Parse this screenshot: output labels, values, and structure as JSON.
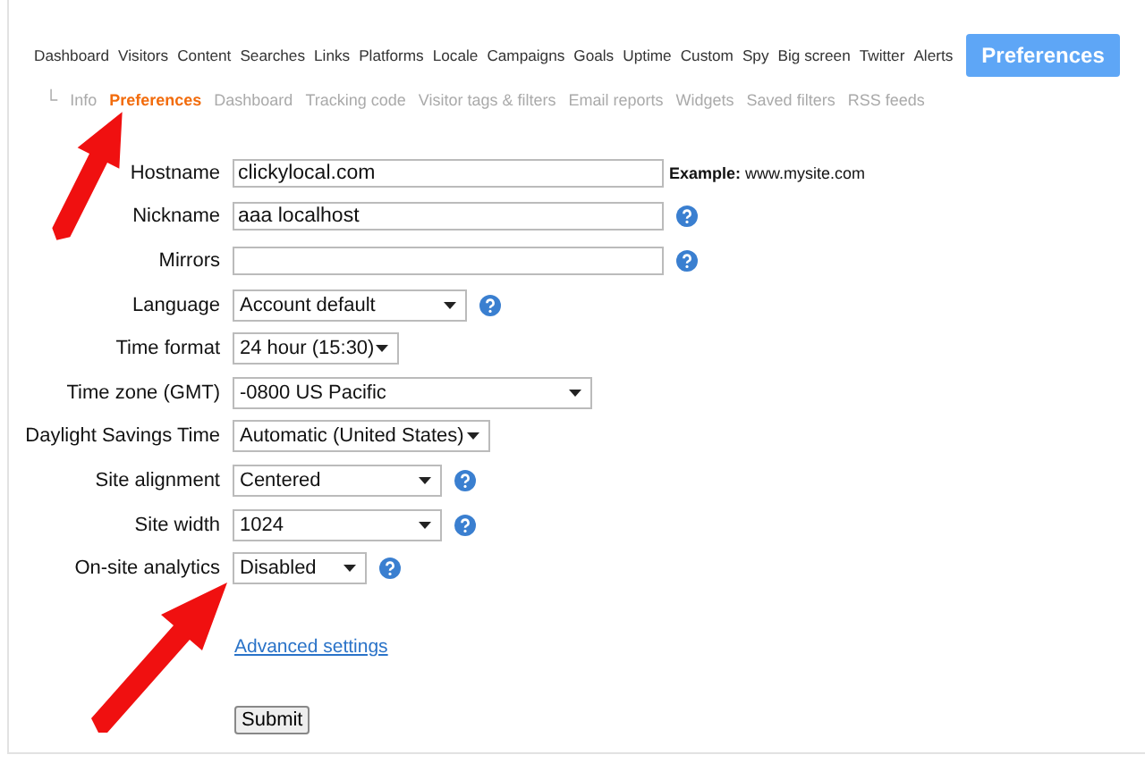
{
  "nav": {
    "tabs": [
      {
        "label": "Dashboard",
        "selected": false
      },
      {
        "label": "Visitors",
        "selected": false
      },
      {
        "label": "Content",
        "selected": false
      },
      {
        "label": "Searches",
        "selected": false
      },
      {
        "label": "Links",
        "selected": false
      },
      {
        "label": "Platforms",
        "selected": false
      },
      {
        "label": "Locale",
        "selected": false
      },
      {
        "label": "Campaigns",
        "selected": false
      },
      {
        "label": "Goals",
        "selected": false
      },
      {
        "label": "Uptime",
        "selected": false
      },
      {
        "label": "Custom",
        "selected": false
      },
      {
        "label": "Spy",
        "selected": false
      },
      {
        "label": "Big screen",
        "selected": false
      },
      {
        "label": "Twitter",
        "selected": false
      },
      {
        "label": "Alerts",
        "selected": false
      },
      {
        "label": "Preferences",
        "selected": true
      }
    ]
  },
  "subnav": {
    "branch": "└",
    "tabs": [
      {
        "label": "Info",
        "selected": false
      },
      {
        "label": "Preferences",
        "selected": true
      },
      {
        "label": "Dashboard",
        "selected": false
      },
      {
        "label": "Tracking code",
        "selected": false
      },
      {
        "label": "Visitor tags & filters",
        "selected": false
      },
      {
        "label": "Email reports",
        "selected": false
      },
      {
        "label": "Widgets",
        "selected": false
      },
      {
        "label": "Saved filters",
        "selected": false
      },
      {
        "label": "RSS feeds",
        "selected": false
      }
    ]
  },
  "form": {
    "fields": [
      {
        "label": "Hostname",
        "kind": "text",
        "value": "clickylocal.com",
        "help": false,
        "note": "**Example:** www.mysite.com"
      },
      {
        "label": "Nickname",
        "kind": "text",
        "value": "aaa localhost",
        "help": true
      },
      {
        "label": "Mirrors",
        "kind": "text",
        "help": true
      },
      {
        "label": "Language",
        "kind": "select",
        "value": "Account default",
        "help": true
      },
      {
        "label": "Time format",
        "kind": "select",
        "value": "24 hour (15:30)",
        "help": false
      },
      {
        "label": "Time zone (GMT)",
        "kind": "select",
        "value": "-0800 US Pacific",
        "help": false
      },
      {
        "label": "Daylight Savings Time",
        "kind": "select",
        "value": "Automatic (United States)",
        "help": false
      },
      {
        "label": "Site alignment",
        "kind": "select",
        "value": "Centered",
        "help": true
      },
      {
        "label": "Site width",
        "kind": "select",
        "value": "1024",
        "help": true
      },
      {
        "label": "On-site analytics",
        "kind": "select",
        "value": "Disabled",
        "help": true
      }
    ],
    "advanced_link": "Advanced settings",
    "submit": "Submit"
  }
}
